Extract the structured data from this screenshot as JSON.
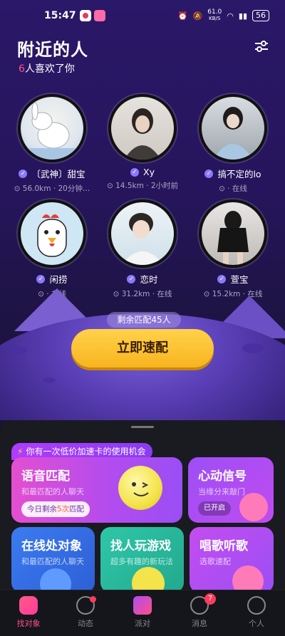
{
  "status": {
    "time": "15:47",
    "network_speed": "61.0",
    "network_unit": "KB/S",
    "battery": "56"
  },
  "header": {
    "title": "附近的人",
    "likes_count": "6",
    "likes_text": "人喜欢了你"
  },
  "users": [
    {
      "name": "〔武神〕甜宝",
      "meta": "56.0km · 20分钟…"
    },
    {
      "name": "Xy",
      "meta": "14.5km · 2小时前"
    },
    {
      "name": "搞不定的lo",
      "meta": "· 在线"
    },
    {
      "name": "闲捞",
      "meta": "· 在线"
    },
    {
      "name": "恋时",
      "meta": "31.2km · 在线"
    },
    {
      "name": "萱宝",
      "meta": "15.2km · 在线"
    }
  ],
  "match": {
    "remaining": "剩余匹配45人",
    "button": "立即速配"
  },
  "promo": {
    "text": "你有一次低价加速卡的使用机会"
  },
  "cards": {
    "voice": {
      "title": "语音匹配",
      "sub": "和最匹配的人聊天",
      "pill_prefix": "今日剩余",
      "pill_highlight": "5次",
      "pill_suffix": "匹配"
    },
    "heart": {
      "title": "心动信号",
      "sub": "当缘分来敲门",
      "pill": "已开启"
    },
    "online": {
      "title": "在线处对象",
      "sub": "和最匹配的人聊天"
    },
    "game": {
      "title": "找人玩游戏",
      "sub": "超多有趣的新玩法"
    },
    "sing": {
      "title": "唱歌听歌",
      "sub": "选歌速配"
    }
  },
  "tabs": [
    {
      "label": "找对象"
    },
    {
      "label": "动态"
    },
    {
      "label": "派对"
    },
    {
      "label": "消息",
      "badge": "7"
    },
    {
      "label": "个人"
    }
  ],
  "colors": {
    "accent": "#ff4f8a",
    "button": "#f8b41f",
    "verified": "#8a79ff"
  }
}
